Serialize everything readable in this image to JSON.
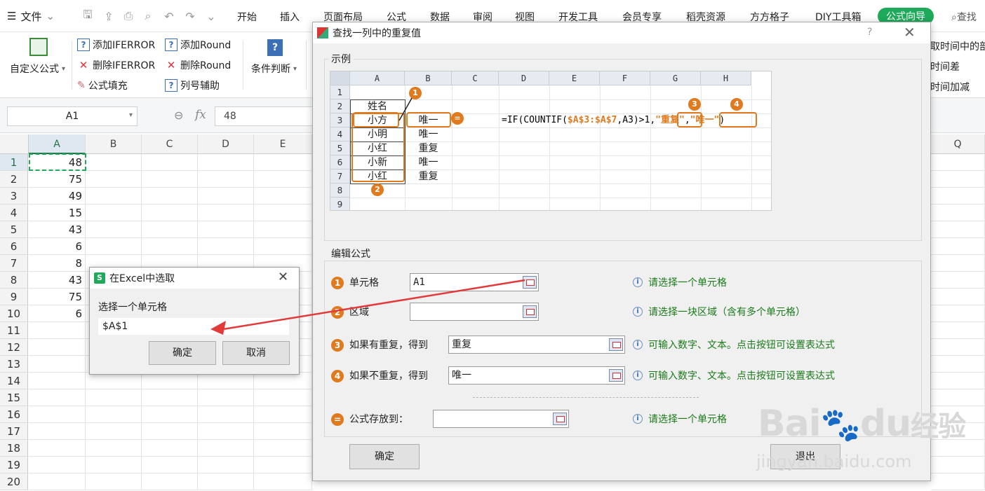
{
  "menubar": {
    "file_label": "文件",
    "tabs": [
      "开始",
      "插入",
      "页面布局",
      "公式",
      "数据",
      "审阅",
      "视图",
      "开发工具",
      "会员专享",
      "稻壳资源",
      "方方格子",
      "DIY工具箱",
      "公式向导",
      "查找"
    ]
  },
  "ribbon": {
    "custom_formula": "自定义公式",
    "add_iferror": "添加IFERROR",
    "del_iferror": "删除IFERROR",
    "formula_fill": "公式填充",
    "add_round": "添加Round",
    "del_round": "删除Round",
    "col_assist": "列号辅助",
    "condition": "条件判断",
    "right_items": [
      "取时间中的部",
      "时间差",
      "时间加减"
    ]
  },
  "formula_bar": {
    "cell_ref": "A1",
    "fx": "fx",
    "value": "48"
  },
  "sheet": {
    "columns": [
      "A",
      "B",
      "C",
      "D",
      "E"
    ],
    "extra_column": "Q",
    "rows": [
      "1",
      "2",
      "3",
      "4",
      "5",
      "6",
      "7",
      "8",
      "9",
      "10",
      "11",
      "12",
      "13",
      "14",
      "15",
      "16",
      "17",
      "18",
      "19",
      "20"
    ],
    "col_a_values": [
      "48",
      "75",
      "49",
      "15",
      "43",
      "6",
      "8",
      "43",
      "75",
      "6"
    ]
  },
  "dialog": {
    "title": "查找一列中的重复值",
    "help": "?",
    "example_label": "示例",
    "example": {
      "cols": [
        "A",
        "B",
        "C",
        "D",
        "E",
        "F",
        "G",
        "H"
      ],
      "rows": [
        "1",
        "2",
        "3",
        "4",
        "5",
        "6",
        "7",
        "8",
        "9"
      ],
      "header": "姓名",
      "names": [
        "小方",
        "小明",
        "小红",
        "小新",
        "小红"
      ],
      "results": [
        "唯一",
        "唯一",
        "重复",
        "唯一",
        "重复"
      ],
      "formula_prefix": "=IF(COUNTIF(",
      "formula_range": "$A$3:$A$7",
      "formula_mid": ",A3)>1,",
      "formula_dup": "\"重复\"",
      "formula_comma": ",",
      "formula_uniq": "\"唯一\"",
      "formula_end": ")",
      "markers": [
        "1",
        "2",
        "3",
        "4",
        "="
      ]
    },
    "edit_label": "编辑公式",
    "fields": [
      {
        "num": "1",
        "label": "单元格",
        "value": "A1",
        "hint": "请选择一个单元格"
      },
      {
        "num": "2",
        "label": "区域",
        "value": "",
        "hint": "请选择一块区域（含有多个单元格）"
      },
      {
        "num": "3",
        "label": "如果有重复，得到",
        "value": "重复",
        "hint": "可输入数字、文本。点击按钮可设置表达式"
      },
      {
        "num": "4",
        "label": "如果不重复，得到",
        "value": "唯一",
        "hint": "可输入数字、文本。点击按钮可设置表达式"
      },
      {
        "num": "=",
        "label": "公式存放到：",
        "value": "",
        "hint": "请选择一个单元格"
      }
    ],
    "ok": "确定",
    "exit": "退出"
  },
  "select_dialog": {
    "title": "在Excel中选取",
    "prompt": "选择一个单元格",
    "value": "$A$1",
    "ok": "确定",
    "cancel": "取消"
  },
  "watermark": {
    "brand": "Bai",
    "mid": "du",
    "cn": "经验",
    "url": "jingyan.baidu.com"
  }
}
